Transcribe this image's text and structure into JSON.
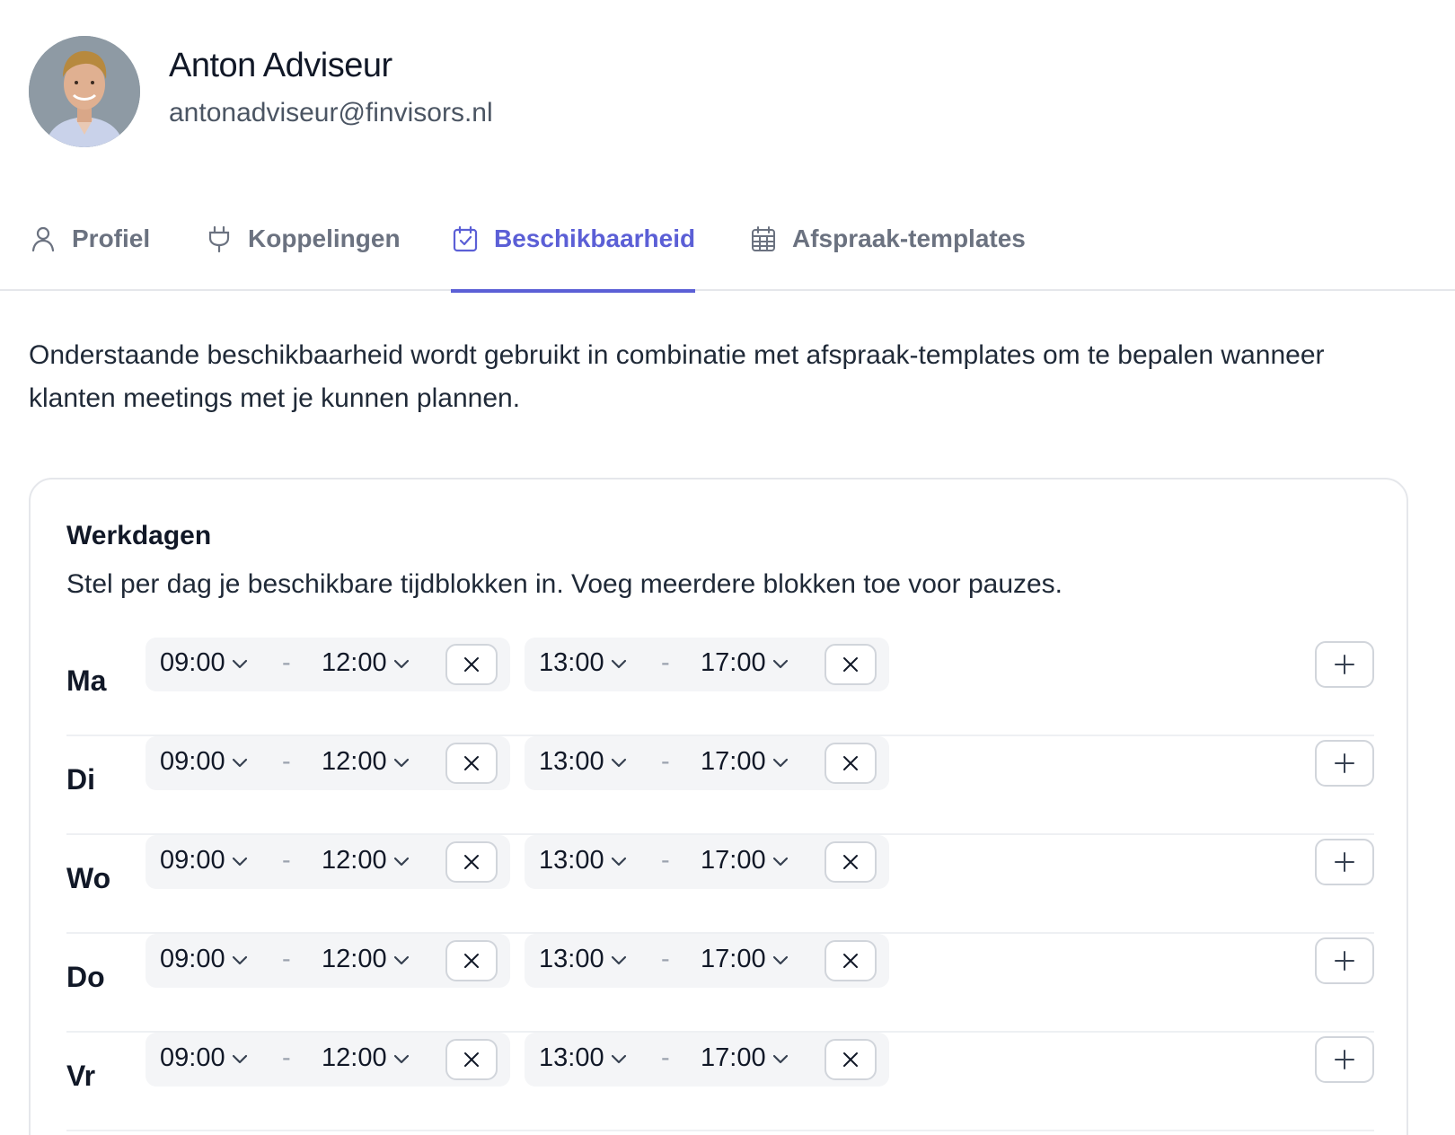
{
  "profile": {
    "name": "Anton Adviseur",
    "email": "antonadviseur@finvisors.nl"
  },
  "tabs": [
    {
      "label": "Profiel",
      "icon": "user-icon",
      "active": false
    },
    {
      "label": "Koppelingen",
      "icon": "plug-icon",
      "active": false
    },
    {
      "label": "Beschikbaarheid",
      "icon": "calendar-check-icon",
      "active": true
    },
    {
      "label": "Afspraak-templates",
      "icon": "calendar-grid-icon",
      "active": false
    }
  ],
  "intro": "Onderstaande beschikbaarheid wordt gebruikt in combinatie met afspraak-templates om te bepalen wanneer klanten meetings met je kunnen plannen.",
  "workdays": {
    "title": "Werkdagen",
    "subtitle": "Stel per dag je beschikbare tijdblokken in. Voeg meerdere blokken toe voor pauzes.",
    "separator": "-",
    "days": [
      {
        "label": "Ma",
        "blocks": [
          {
            "start": "09:00",
            "end": "12:00"
          },
          {
            "start": "13:00",
            "end": "17:00"
          }
        ]
      },
      {
        "label": "Di",
        "blocks": [
          {
            "start": "09:00",
            "end": "12:00"
          },
          {
            "start": "13:00",
            "end": "17:00"
          }
        ]
      },
      {
        "label": "Wo",
        "blocks": [
          {
            "start": "09:00",
            "end": "12:00"
          },
          {
            "start": "13:00",
            "end": "17:00"
          }
        ]
      },
      {
        "label": "Do",
        "blocks": [
          {
            "start": "09:00",
            "end": "12:00"
          },
          {
            "start": "13:00",
            "end": "17:00"
          }
        ]
      },
      {
        "label": "Vr",
        "blocks": [
          {
            "start": "09:00",
            "end": "12:00"
          },
          {
            "start": "13:00",
            "end": "17:00"
          }
        ]
      }
    ]
  },
  "colors": {
    "accent": "#5b5fd6",
    "muted_text": "#6b7280",
    "border": "#e5e7eb",
    "block_bg": "#f4f5f7"
  }
}
